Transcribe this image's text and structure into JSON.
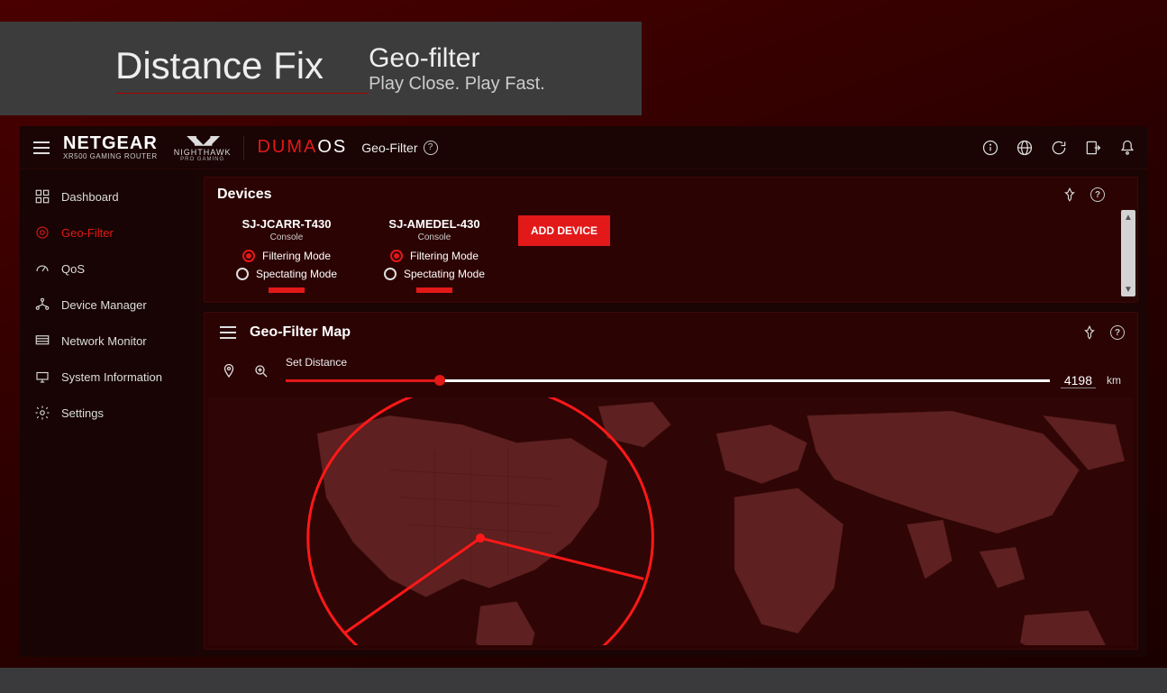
{
  "banner": {
    "headline": "Distance Fix",
    "title": "Geo-filter",
    "subtitle": "Play Close. Play Fast."
  },
  "brand": {
    "netgear": "NETGEAR",
    "netgear_sub": "XR500 GAMING ROUTER",
    "nighthawk": "NIGHTHAWK",
    "nighthawk_sub": "PRO GAMING",
    "duma": "DUMA",
    "os": "OS"
  },
  "breadcrumb": {
    "label": "Geo-Filter"
  },
  "sidebar": {
    "items": [
      {
        "label": "Dashboard"
      },
      {
        "label": "Geo-Filter"
      },
      {
        "label": "QoS"
      },
      {
        "label": "Device Manager"
      },
      {
        "label": "Network Monitor"
      },
      {
        "label": "System Information"
      },
      {
        "label": "Settings"
      }
    ]
  },
  "devices_panel": {
    "title": "Devices",
    "add_label": "ADD DEVICE",
    "cards": [
      {
        "name": "SJ-JCARR-T430",
        "type": "Console",
        "filtering": "Filtering Mode",
        "spectating": "Spectating Mode"
      },
      {
        "name": "SJ-AMEDEL-430",
        "type": "Console",
        "filtering": "Filtering Mode",
        "spectating": "Spectating Mode"
      }
    ]
  },
  "map_panel": {
    "title": "Geo-Filter Map",
    "distance_label": "Set Distance",
    "distance_value": "4198",
    "distance_unit": "km"
  }
}
